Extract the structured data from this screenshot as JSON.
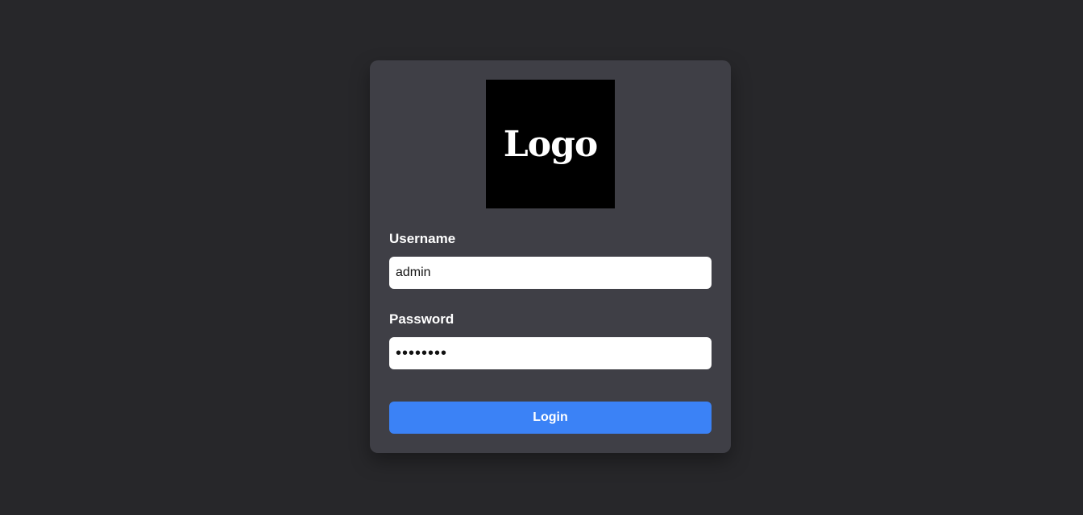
{
  "logo": {
    "text": "Logo",
    "background": "#000000",
    "color": "#ffffff"
  },
  "form": {
    "username": {
      "label": "Username",
      "value": "admin"
    },
    "password": {
      "label": "Password",
      "value": "password"
    },
    "login_label": "Login"
  },
  "colors": {
    "page_background": "#27272a",
    "card_background": "#3f3f46",
    "accent": "#3b82f6"
  }
}
